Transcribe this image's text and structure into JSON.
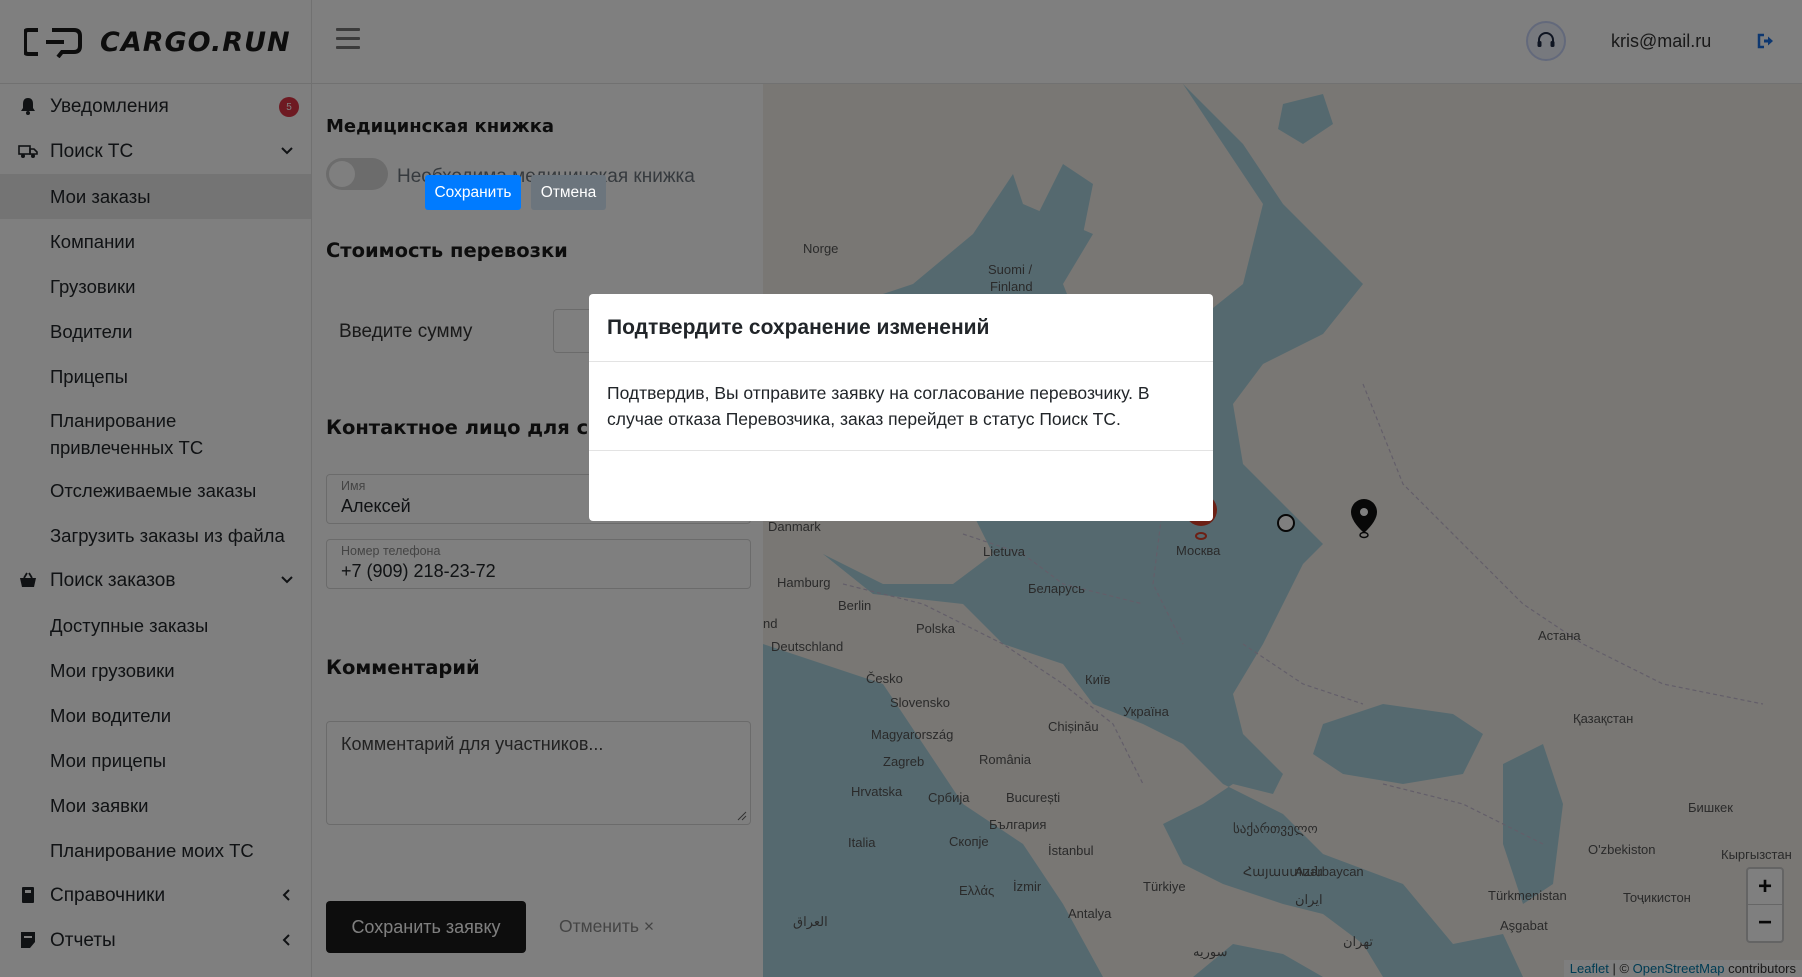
{
  "header": {
    "brand": "CARGO.RUN",
    "user_email": "kris@mail.ru"
  },
  "sidebar": {
    "notifications": {
      "label": "Уведомления",
      "badge": "5"
    },
    "vehicle_search": {
      "label": "Поиск ТС",
      "items": [
        "Мои заказы",
        "Компании",
        "Грузовики",
        "Водители",
        "Прицепы",
        "Планирование привлеченных ТС",
        "Отслеживаемые заказы",
        "Загрузить заказы из файла"
      ]
    },
    "order_search": {
      "label": "Поиск заказов",
      "items": [
        "Доступные заказы",
        "Мои грузовики",
        "Мои водители",
        "Мои прицепы",
        "Мои заявки",
        "Планирование моих ТС"
      ]
    },
    "references": {
      "label": "Справочники"
    },
    "reports": {
      "label": "Отчеты"
    }
  },
  "form": {
    "medical_title": "Медицинская книжка",
    "medical_toggle_label": "Необходима медицинская книжка",
    "cost_title": "Стоимость перевозки",
    "sum_label": "Введите сумму",
    "contact_title": "Контактное лицо для связи",
    "name_label": "Имя",
    "name_value": "Алексей",
    "phone_label": "Номер телефона",
    "phone_value": "+7 (909) 218-23-72",
    "comment_title": "Комментарий",
    "comment_placeholder": "Комментарий для участников...",
    "save_button": "Сохранить заявку",
    "cancel_link": "Отменить ×"
  },
  "map": {
    "labels": {
      "norge": "Norge",
      "suomi": "Suomi /",
      "finland": "Finland",
      "danmark": "Danmark",
      "hamburg": "Hamburg",
      "berlin": "Berlin",
      "deutschland": "Deutschland",
      "nd": "nd",
      "lietuva": "Lietuva",
      "polska": "Polska",
      "belarus": "Беларусь",
      "moskva": "Москва",
      "cesko": "Česko",
      "slovensko": "Slovensko",
      "magyarorszag": "Magyarország",
      "zagreb": "Zagreb",
      "hrvatska": "Hrvatska",
      "srbija": "Србија",
      "romania": "România",
      "bucuresti": "București",
      "bulgaria": "България",
      "italia": "Italia",
      "skopje": "Скопје",
      "ellas": "Ελλάς",
      "istanbul": "İstanbul",
      "izmir": "İzmir",
      "turkiye": "Türkiye",
      "antalya": "Antalya",
      "kyiv": "Київ",
      "chisinau": "Chișinău",
      "ukraina": "Україна",
      "sakartvelo": "საქართველო",
      "hayastan": "Հայաստան",
      "azerbaycan": "Azərbaycan",
      "iran": "ایران",
      "tehran": "تهران",
      "syria": "سوریه",
      "iraq": "العراق",
      "astana": "Астана",
      "kazakhstan": "Қазақстан",
      "bishkek": "Бишкек",
      "kyrgyzstan": "Кыргызстан",
      "ozbekiston": "O'zbekiston",
      "turkmenistan": "Türkmenistan",
      "tochikiston": "Тоҷикистон",
      "ashgabat": "Aşgabat"
    },
    "zoom_in": "+",
    "zoom_out": "−",
    "attribution_leaflet": "Leaflet",
    "attribution_sep": "| ©",
    "attribution_osm": "OpenStreetMap",
    "attribution_tail": "contributors"
  },
  "modal": {
    "title": "Подтвердите сохранение изменений",
    "body": "Подтвердив, Вы отправите заявку на согласование перевозчику. В случае отказа Перевозчика, заказ перейдет в статус Поиск ТС.",
    "confirm": "Сохранить",
    "cancel": "Отмена"
  },
  "colors": {
    "primary": "#007bff",
    "secondary": "#6c757d",
    "danger": "#dc3545",
    "dark_button": "#1b1b1b"
  }
}
